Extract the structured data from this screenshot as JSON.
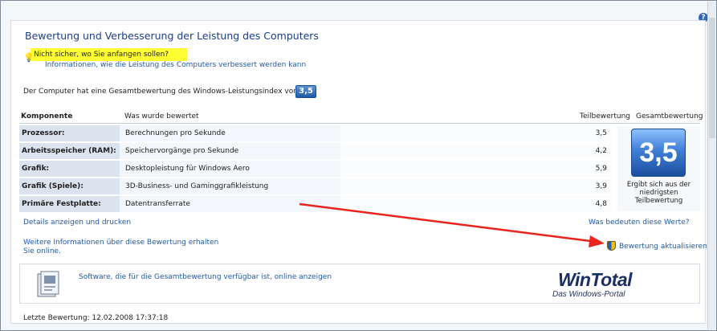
{
  "help_button": "?",
  "page_title": "Bewertung und Verbesserung der Leistung des Computers",
  "hint": {
    "icon": "lightbulb-icon",
    "highlight_color": "#ffff33",
    "question": "Nicht sicher, wo Sie anfangen sollen?",
    "link": "Informationen, wie die Leistung des Computers verbessert werden kann"
  },
  "summary": {
    "text": "Der Computer hat eine Gesamtbewertung des Windows-Leistungsindex von",
    "score": "3,5"
  },
  "table": {
    "headers": {
      "component": "Komponente",
      "what": "Was wurde bewertet",
      "subscore": "Teilbewertung",
      "total": "Gesamtbewertung"
    },
    "rows": [
      {
        "component": "Prozessor:",
        "what": "Berechnungen pro Sekunde",
        "subscore": "3,5"
      },
      {
        "component": "Arbeitsspeicher (RAM):",
        "what": "Speichervorgänge pro Sekunde",
        "subscore": "4,2"
      },
      {
        "component": "Grafik:",
        "what": "Desktopleistung für Windows Aero",
        "subscore": "5,9"
      },
      {
        "component": "Grafik (Spiele):",
        "what": "3D-Business- und Gaminggrafikleistung",
        "subscore": "3,9"
      },
      {
        "component": "Primäre Festplatte:",
        "what": "Datentransferrate",
        "subscore": "4,8"
      }
    ],
    "total_score": "3,5",
    "total_caption": "Ergibt sich aus der niedrigsten Teilbewertung"
  },
  "links": {
    "details": "Details anzeigen und drucken",
    "meaning": "Was bedeuten diese Werte?",
    "more_info": "Weitere Informationen über diese Bewertung erhalten",
    "online": "Sie online.",
    "update": "Bewertung aktualisieren",
    "update_icon": "shield-icon"
  },
  "software_box": {
    "icon": "software-box-icon",
    "link": "Software, die für die Gesamtbewertung verfügbar ist, online anzeigen",
    "logo": "WinTotal",
    "logo_sub": "Das Windows-Portal"
  },
  "last_rating": "Letzte Bewertung: 12.02.2008 17:37:18",
  "colors": {
    "link": "#2359a7",
    "title": "#1a3e86",
    "arrow": "#e8241c",
    "badge": "#2f68b5"
  }
}
